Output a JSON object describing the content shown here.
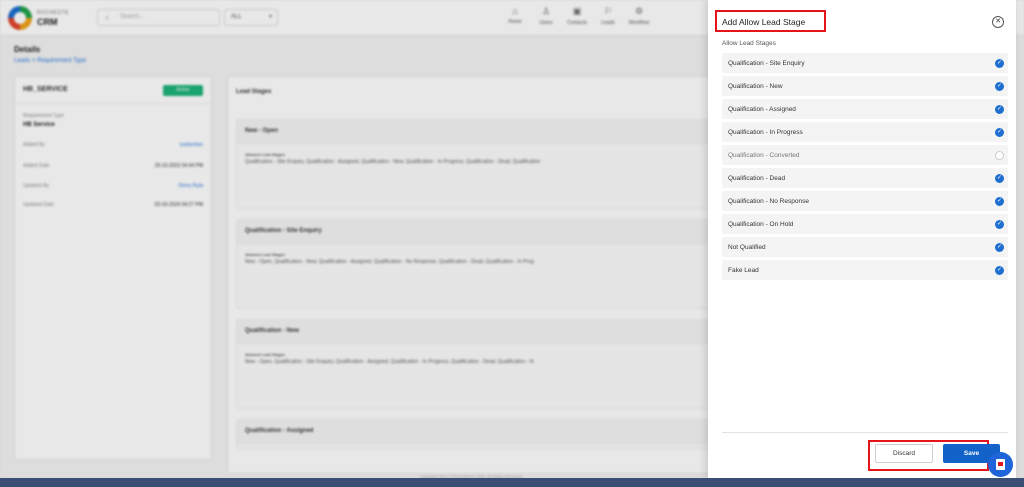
{
  "app": {
    "brand_sub": "ROCHESTE",
    "brand": "CRM",
    "search_placeholder": "Search...",
    "filter_value": "ALL",
    "nav": [
      {
        "label": "Home",
        "icon": "home-icon"
      },
      {
        "label": "Users",
        "icon": "users-icon"
      },
      {
        "label": "Contacts",
        "icon": "contacts-icon"
      },
      {
        "label": "Leads",
        "icon": "leads-icon"
      },
      {
        "label": "Workflow",
        "icon": "workflow-icon"
      }
    ],
    "page_title": "Details",
    "breadcrumb": "Leads  >  Requirement Type",
    "footer": "Copyright 2024 © ROCHESTE CRM. All Rights Reserved."
  },
  "left_card": {
    "title": "HB_SERVICE",
    "badge": "Active",
    "req_label": "Requirement Type",
    "req_value": "HB Service",
    "rows": [
      {
        "key": "Added By",
        "value": "sudarshan"
      },
      {
        "key": "Added Date",
        "value": "29-10-2023 04:44 PM"
      },
      {
        "key": "Updated By",
        "value": "Dinny Ryta"
      },
      {
        "key": "Updated Date",
        "value": "02-03-2024 04:27 PM"
      }
    ]
  },
  "main_card": {
    "heading": "Lead Stages",
    "blocks": [
      {
        "title": "New - Open",
        "label": "Allowed Lead Stages",
        "text": "Qualification - Site Enquiry, Qualification - Assigned, Qualification - New, Qualification - In Progress, Qualification - Dead, Qualification"
      },
      {
        "title": "Qualification - Site Enquiry",
        "label": "Allowed Lead Stages",
        "text": "New - Open, Qualification - New, Qualification - Assigned, Qualification - No Response, Qualification - Dead, Qualification - In Prog"
      },
      {
        "title": "Qualification - New",
        "label": "Allowed Lead Stages",
        "text": "New - Open, Qualification - Site Enquiry, Qualification - Assigned, Qualification - In Progress, Qualification - Dead, Qualification - N"
      },
      {
        "title": "Qualification - Assigned",
        "label": "",
        "text": ""
      }
    ]
  },
  "modal": {
    "title": "Add Allow Lead Stage",
    "subtitle": "Allow Lead Stages",
    "stages": [
      {
        "label": "Qualification - Site Enquiry",
        "checked": true
      },
      {
        "label": "Qualification - New",
        "checked": true
      },
      {
        "label": "Qualification - Assigned",
        "checked": true
      },
      {
        "label": "Qualification - In Progress",
        "checked": true
      },
      {
        "label": "Qualification - Converted",
        "checked": false
      },
      {
        "label": "Qualification - Dead",
        "checked": true
      },
      {
        "label": "Qualification - No Response",
        "checked": true
      },
      {
        "label": "Qualification - On Hold",
        "checked": true
      },
      {
        "label": "Not Qualified",
        "checked": true
      },
      {
        "label": "Fake Lead",
        "checked": true
      }
    ],
    "discard_label": "Discard",
    "save_label": "Save",
    "check_glyph": "✓",
    "close_glyph": "✕"
  },
  "colors": {
    "accent": "#1262c9",
    "highlight": "#e4141b",
    "badge": "#1db37a"
  }
}
